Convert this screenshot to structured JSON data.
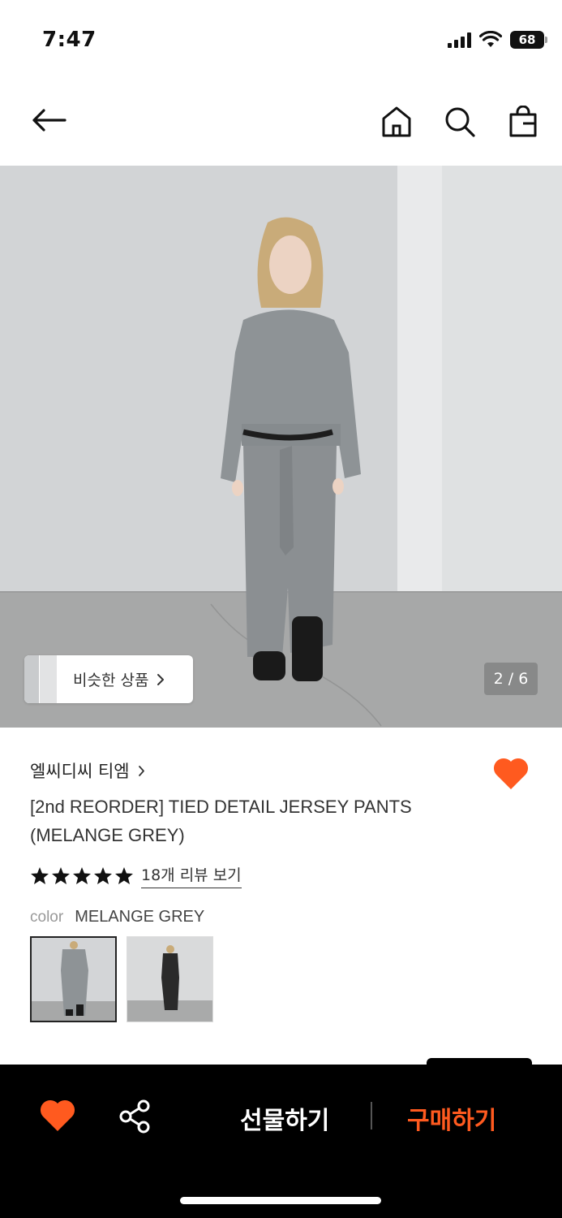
{
  "status_bar": {
    "time": "7:47",
    "battery": "68",
    "icons": [
      "signal-icon",
      "wifi-icon",
      "battery-icon"
    ]
  },
  "nav": {
    "icons": [
      "back-arrow-icon",
      "home-icon",
      "search-icon",
      "shopping-bag-icon"
    ]
  },
  "hero": {
    "similar_label": "비슷한 상품",
    "page_indicator": "2 / 6"
  },
  "product": {
    "brand": "엘씨디씨 티엠",
    "title": "[2nd REORDER] TIED DETAIL JERSEY PANTS (MELANGE GREY)",
    "rating_stars": 5,
    "review_link": "18개 리뷰 보기",
    "color_label": "color",
    "color_value": "MELANGE GREY",
    "liked": true
  },
  "bottom_bar": {
    "gift_label": "선물하기",
    "buy_label": "구매하기"
  },
  "colors": {
    "accent": "#ff5a1f",
    "bar_bg": "#000000"
  }
}
